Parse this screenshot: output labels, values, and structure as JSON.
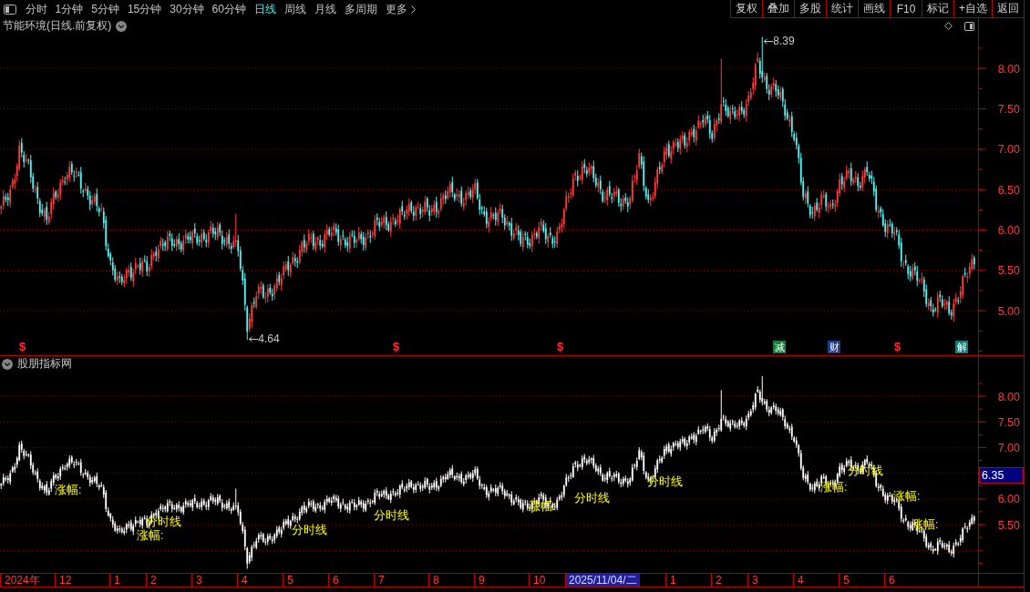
{
  "toolbar": {
    "periods": [
      {
        "label": "分时",
        "selected": false,
        "kind": "period"
      },
      {
        "label": "1分钟",
        "selected": false,
        "kind": "period"
      },
      {
        "label": "5分钟",
        "selected": false,
        "kind": "period"
      },
      {
        "label": "15分钟",
        "selected": false,
        "kind": "period"
      },
      {
        "label": "30分钟",
        "selected": false,
        "kind": "period"
      },
      {
        "label": "60分钟",
        "selected": false,
        "kind": "period"
      },
      {
        "label": "日线",
        "selected": true,
        "kind": "period"
      },
      {
        "label": "周线",
        "selected": false,
        "kind": "period"
      },
      {
        "label": "月线",
        "selected": false,
        "kind": "period"
      },
      {
        "label": "多周期",
        "selected": false,
        "kind": "period"
      },
      {
        "label": "更多",
        "selected": false,
        "kind": "menu"
      }
    ],
    "actions": [
      "复权",
      "叠加",
      "多股",
      "统计",
      "画线",
      "F10",
      "标记",
      "+自选",
      "返回"
    ]
  },
  "price_panel": {
    "title": "节能环境(日线.前复权)",
    "price_axis": [
      "8.00",
      "7.50",
      "7.00",
      "6.50",
      "6.00",
      "5.50",
      "5.00"
    ],
    "high_label": "8.39",
    "low_label": "4.64",
    "event_markers": [
      {
        "label": "$",
        "kind": "text",
        "color": "#ff2d2d"
      },
      {
        "label": "$",
        "kind": "text",
        "color": "#ff2d2d"
      },
      {
        "label": "$",
        "kind": "text",
        "color": "#ff2d2d"
      },
      {
        "label": "减",
        "kind": "tag",
        "color": "#15803a"
      },
      {
        "label": "财",
        "kind": "tag",
        "color": "#1e3f8c"
      },
      {
        "label": "$",
        "kind": "text",
        "color": "#ff2d2d"
      },
      {
        "label": "解",
        "kind": "tag",
        "color": "#137a78"
      }
    ]
  },
  "indicator_panel": {
    "title": "股朋指标网",
    "value_axis": [
      "8.00",
      "7.50",
      "7.00",
      "6.00",
      "5.50"
    ],
    "cursor_value": "6.35",
    "labels": [
      "涨幅:",
      "分时线",
      "涨幅:",
      "分时线",
      "分时线",
      "涨幅:",
      "分时线",
      "分时线",
      "涨幅:",
      "分时线",
      "涨幅:",
      "涨幅:"
    ]
  },
  "date_axis": {
    "labels": [
      "2024年",
      "12",
      "1",
      "2",
      "3",
      "4",
      "5",
      "6",
      "7",
      "8",
      "9",
      "10",
      "1",
      "2",
      "3",
      "4",
      "5",
      "6"
    ],
    "cursor_date": "2025/11/04/二"
  }
}
